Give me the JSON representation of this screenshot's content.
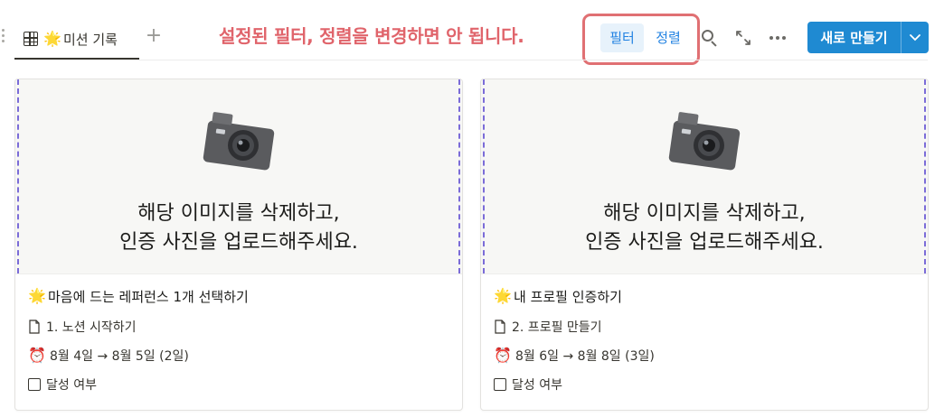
{
  "tabs": [
    {
      "label": "미션 기록",
      "icon": "grid-icon",
      "emoji": "star-icon"
    }
  ],
  "annotation": {
    "warning": "설정된 필터, 정렬을 변경하면 안 됩니다."
  },
  "toolbar": {
    "filter_label": "필터",
    "sort_label": "정렬",
    "new_label": "새로 만들기"
  },
  "colors": {
    "accent": "#2383e2",
    "primary_button": "#1f8ad2",
    "warning": "#e0646b"
  },
  "cards": [
    {
      "cover_line1": "해당 이미지를 삭제하고,",
      "cover_line2": "인증 사진을 업로드해주세요.",
      "title": "마음에 드는 레퍼런스 1개 선택하기",
      "relation": "1. 노션 시작하기",
      "date": "8월 4일 → 8월 5일 (2일)",
      "checkbox_label": "달성 여부"
    },
    {
      "cover_line1": "해당 이미지를 삭제하고,",
      "cover_line2": "인증 사진을 업로드해주세요.",
      "title": "내 프로필 인증하기",
      "relation": "2. 프로필 만들기",
      "date": "8월 6일 → 8월 8일 (3일)",
      "checkbox_label": "달성 여부"
    }
  ]
}
